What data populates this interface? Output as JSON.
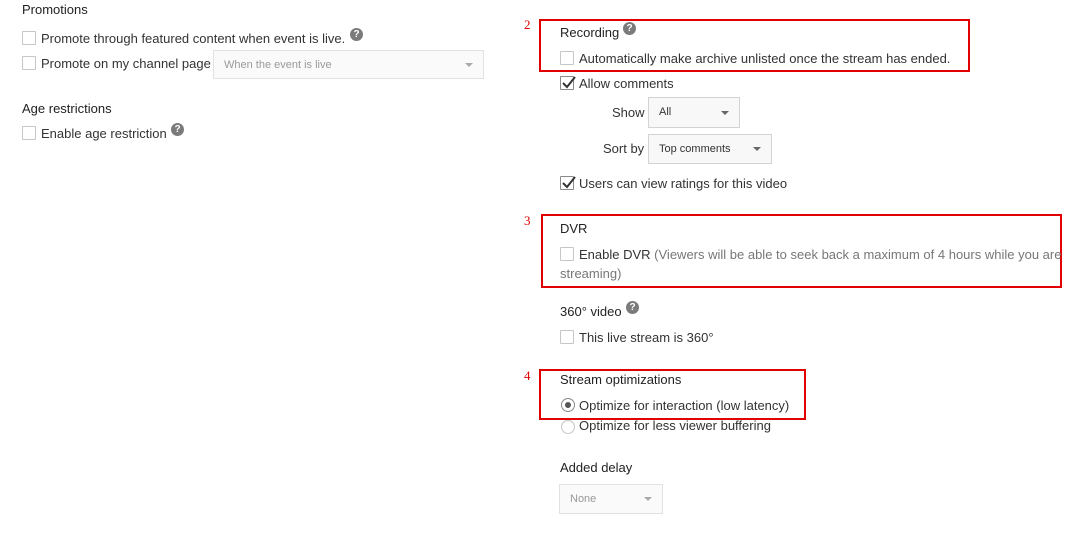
{
  "promotions": {
    "heading": "Promotions",
    "featured_label": "Promote through featured content when event is live.",
    "channel_label": "Promote on my channel page",
    "channel_select": "When the event is live",
    "help_glyph": "?"
  },
  "age": {
    "heading": "Age restrictions",
    "enable_label": "Enable age restriction"
  },
  "annotations": {
    "n2": "2",
    "n3": "3",
    "n4": "4",
    "box_color": "#e00000"
  },
  "recording": {
    "heading": "Recording",
    "unlisted_label": "Automatically make archive unlisted once the stream has ended."
  },
  "comments": {
    "allow_label": "Allow comments",
    "allow_checked": true,
    "show_label": "Show",
    "show_value": "All",
    "sort_label": "Sort by",
    "sort_value": "Top comments",
    "ratings_label": "Users can view ratings for this video",
    "ratings_checked": true
  },
  "dvr": {
    "heading": "DVR",
    "enable_label": "Enable DVR",
    "note_line1": "(Viewers will be able to seek back a maximum of 4 hours while you are",
    "note_line2": "streaming)"
  },
  "video360": {
    "heading": "360° video",
    "label": "This live stream is 360°"
  },
  "stream_opt": {
    "heading": "Stream optimizations",
    "option1": "Optimize for interaction (low latency)",
    "option1_selected": true,
    "option2": "Optimize for less viewer buffering",
    "option2_selected": false
  },
  "delay": {
    "heading": "Added delay",
    "value": "None"
  }
}
